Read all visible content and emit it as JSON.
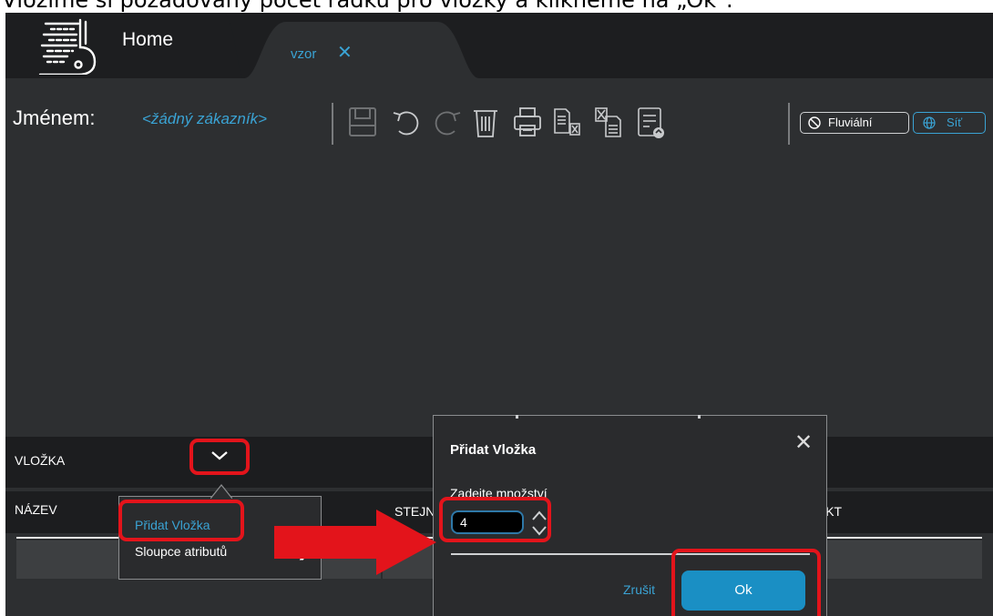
{
  "caption": "Vložíme si požadovaný počet řádků pro vložky a klikneme na „Ok\".",
  "app": {
    "home_tab": "Home",
    "doc_tab": "vzor",
    "doc_tab_close": "✕",
    "icons": [
      "logo-icon",
      "save-icon",
      "undo-icon",
      "redo-icon",
      "delete-icon",
      "print-icon",
      "export-excel-icon",
      "import-excel-icon",
      "report-icon",
      "globe-icon"
    ]
  },
  "toolbar": {
    "customer_label": "Jménem:",
    "customer_value": "<žádný zákazník>",
    "mode_fluvial": "Fluviální",
    "mode_network": "Síť"
  },
  "table": {
    "section_label": "VLOŽKA",
    "col_name": "NÁZEV",
    "col_same": "STEJN",
    "col_product": "DUKT"
  },
  "context_menu": {
    "add": "Přidat Vložka",
    "attributes": "Sloupce atributů",
    "chevron": "❯"
  },
  "dialog": {
    "title": "Přidat Vložka",
    "close": "✕",
    "quantity_label": "Zadeite množství",
    "quantity_value": "4",
    "cancel": "Zrušit",
    "ok": "Ok"
  },
  "colors": {
    "accent": "#3aa3d4",
    "annotation_red": "#e3141b",
    "app_bg": "#2d2f31",
    "titlebar_bg": "#1d1e20",
    "ok_button": "#1a8fc4"
  }
}
